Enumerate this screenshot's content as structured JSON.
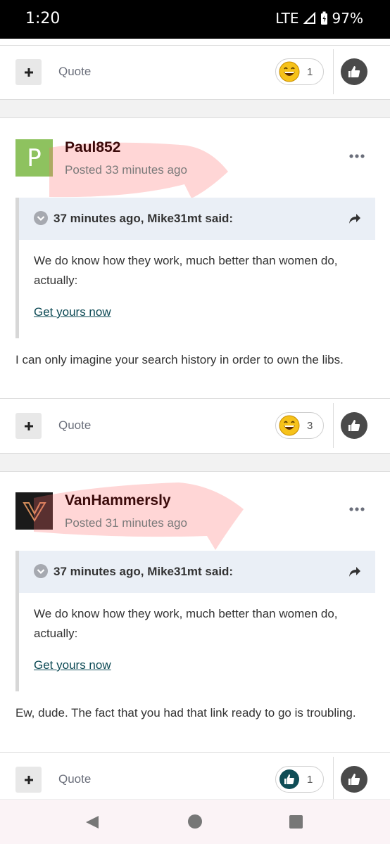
{
  "status_bar": {
    "time": "1:20",
    "network": "LTE",
    "battery": "97%"
  },
  "top_actions": {
    "quote_label": "Quote",
    "reaction_count": "1",
    "reaction_icon": "laughing-emoji"
  },
  "posts": [
    {
      "author": "Paul852",
      "avatar_letter": "P",
      "avatar_color": "#8ec25f",
      "posted": "Posted 33 minutes ago",
      "quote_header": "37 minutes ago, Mike31mt said:",
      "quote_text": "We do know how they work, much better than women do, actually:",
      "quote_link": "Get yours now",
      "body": "I can only imagine your search history in order to own the libs.",
      "quote_label": "Quote",
      "reaction_count": "3",
      "reaction_icon": "laughing-emoji"
    },
    {
      "author": "VanHammersly",
      "posted": "Posted 31 minutes ago",
      "quote_header": "37 minutes ago, Mike31mt said:",
      "quote_text": "We do know how they work, much better than women do, actually:",
      "quote_link": "Get yours now",
      "body": "Ew, dude.  The fact that you had that link ready to go is troubling.",
      "quote_label": "Quote",
      "reaction_count": "1",
      "reaction_icon": "thumbs-up"
    }
  ],
  "colors": {
    "author": "#3a0a0a",
    "link": "#0d4a55",
    "quote_bg": "#eaeff6",
    "highlight": "#ff6b6b"
  }
}
